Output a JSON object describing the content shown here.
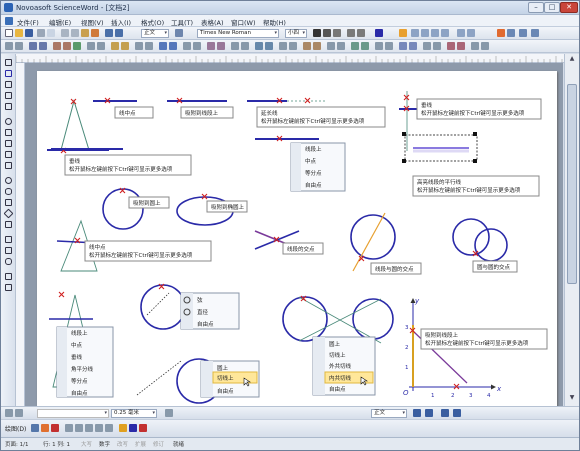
{
  "window": {
    "title": "Novoasoft ScienceWord - [文档2]",
    "min": "–",
    "max": "□",
    "close": "✕"
  },
  "menu": [
    "文件(F)",
    "编辑(E)",
    "视图(V)",
    "插入(I)",
    "格式(O)",
    "工具(T)",
    "表格(A)",
    "窗口(W)",
    "帮助(H)"
  ],
  "toolbar": {
    "style": "正文",
    "font": "Times New Roman",
    "size": "小四"
  },
  "prop": {
    "line_width": "0.25 毫米",
    "text_style": "正文"
  },
  "drawbar": {
    "label": "绘图(D)"
  },
  "status": {
    "page": "页面: 1/1",
    "position": "行: 1   列: 1",
    "modes": [
      "大写",
      "数字",
      "改写",
      "扩展",
      "修订"
    ],
    "state": "就绪"
  },
  "tooltips": {
    "t1": "线中点",
    "t2": "吸附到线段上",
    "t3a": "延长线",
    "t3b": "松开鼠标左键前按下Ctrl键可显示更多选项",
    "t4a": "垂线",
    "t4b": "松开鼠标左键前按下Ctrl键可显示更多选项",
    "t5a": "垂线",
    "t5b": "松开鼠标左键前按下Ctrl键可显示更多选项",
    "t6": "吸附到圆上",
    "t7": "吸附到椭圆上",
    "t8a": "高亮线段的平行线",
    "t8b": "松开鼠标左键前按下Ctrl键可显示更多选项",
    "t9a": "线中点",
    "t9b": "松开鼠标左键前按下Ctrl键可显示更多选项",
    "t10": "线段的交点",
    "t11": "线段与圆的交点",
    "t12": "圆与圆的交点",
    "t13a": "吸附到线段上",
    "t13b": "松开鼠标左键前按下Ctrl键可显示更多选项"
  },
  "menus": {
    "m1": [
      "线段上",
      "中点",
      "等分点",
      "自由点"
    ],
    "m2": [
      "弦",
      "直径",
      "自由点"
    ],
    "m3": [
      "线段上",
      "中点",
      "垂线",
      "角平分线",
      "等分点",
      "自由点"
    ],
    "m4": [
      "圆上",
      "切线上",
      "自由点"
    ],
    "m5": [
      "圆上",
      "切线上",
      "外共切线",
      "内共切线",
      "自由点"
    ]
  },
  "axes": {
    "x": "x",
    "y": "y",
    "o": "O",
    "xt": [
      "1",
      "2",
      "3",
      "4"
    ],
    "yt": [
      "1",
      "2",
      "3"
    ]
  },
  "colors": {
    "accent": "#2a2aa8",
    "marker": "#d02020",
    "highlight": "#ffe79a",
    "geom": "#3a8a6a"
  }
}
